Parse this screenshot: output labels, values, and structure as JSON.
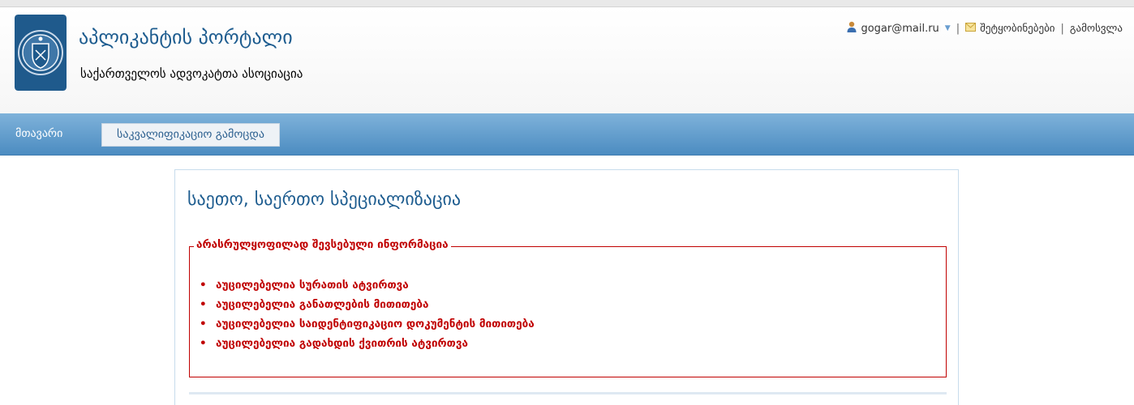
{
  "header": {
    "title": "აპლიკანტის პორტალი",
    "subtitle": "საქართველოს ადვოკატთა ასოციაცია"
  },
  "userbar": {
    "email": "gogar@mail.ru",
    "separator": "|",
    "messages": "შეტყობინებები",
    "logout": "გამოსვლა",
    "icons": [
      "user-icon",
      "caret-down-icon",
      "envelope-icon"
    ]
  },
  "nav": {
    "home": "მთავარი",
    "exam": "საკვალიფიკაციო გამოცდა"
  },
  "panel": {
    "title": "საეთო, საერთო სპეციალიზაცია",
    "legend": "არასრულყოფილად შევსებული ინფორმაცია",
    "items": [
      "აუცილებელია სურათის ატვირთვა",
      "აუცილებელია განათლების მითითება",
      "აუცილებელია საიდენტიფიკაციო დოკუმენტის მითითება",
      "აუცილებელია გადახდის ქვითრის ატვირთვა"
    ],
    "bullet": "•"
  },
  "colors": {
    "accent": "#1d5c8f",
    "nav": "#4c8cc1",
    "error": "#c00000"
  }
}
